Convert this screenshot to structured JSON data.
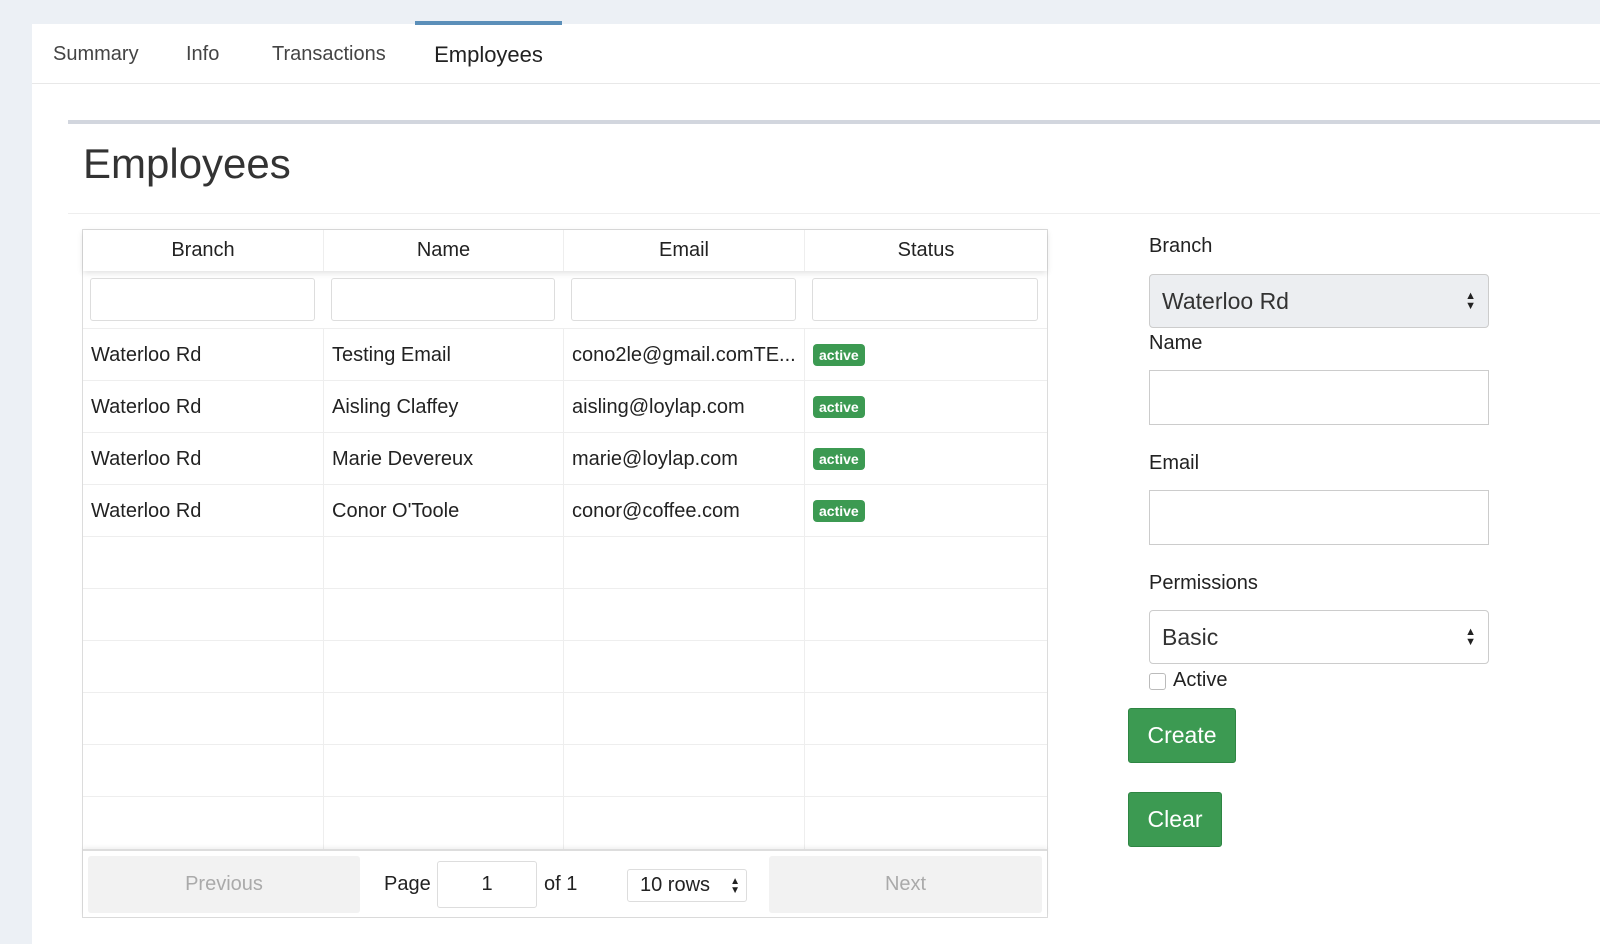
{
  "tabs": [
    {
      "label": "Summary"
    },
    {
      "label": "Info"
    },
    {
      "label": "Transactions"
    },
    {
      "label": "Employees"
    }
  ],
  "box": {
    "title": "Employees"
  },
  "table": {
    "headers": [
      "Branch",
      "Name",
      "Email",
      "Status"
    ],
    "rows": [
      {
        "branch": "Waterloo Rd",
        "name": "Testing Email",
        "email": "cono2le@gmail.comTE...",
        "status": "active"
      },
      {
        "branch": "Waterloo Rd",
        "name": "Aisling Claffey",
        "email": "aisling@loylap.com",
        "status": "active"
      },
      {
        "branch": "Waterloo Rd",
        "name": "Marie Devereux",
        "email": "marie@loylap.com",
        "status": "active"
      },
      {
        "branch": "Waterloo Rd",
        "name": "Conor O'Toole",
        "email": "conor@coffee.com",
        "status": "active"
      }
    ],
    "status_color": "#3c9a52"
  },
  "pagination": {
    "previous": "Previous",
    "page_label": "Page",
    "page_value": "1",
    "of_label": "of 1",
    "rows_select": "10 rows",
    "next": "Next"
  },
  "form": {
    "branch_label": "Branch",
    "branch_value": "Waterloo Rd",
    "name_label": "Name",
    "email_label": "Email",
    "permissions_label": "Permissions",
    "permissions_value": "Basic",
    "active_label": "Active",
    "create_label": "Create",
    "clear_label": "Clear"
  }
}
